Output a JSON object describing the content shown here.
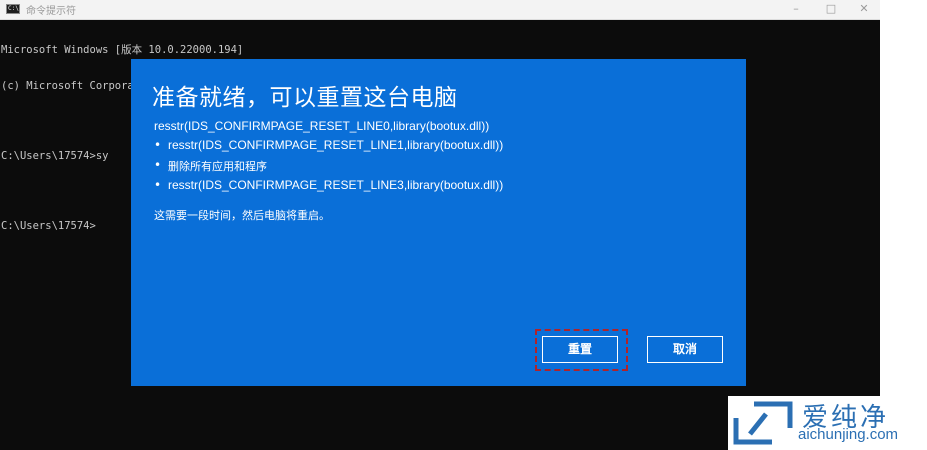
{
  "titlebar": {
    "icon_text": "C:\\",
    "title": "命令提示符",
    "minimize": "–",
    "maximize": "□",
    "close": "✕"
  },
  "console": {
    "lines": [
      "Microsoft Windows [版本 10.0.22000.194]",
      "(c) Microsoft Corporation。保留所有权利。",
      "",
      "C:\\Users\\17574>sy",
      "",
      "C:\\Users\\17574>"
    ]
  },
  "dialog": {
    "title": "准备就绪，可以重置这台电脑",
    "line0": "resstr(IDS_CONFIRMPAGE_RESET_LINE0,library(bootux.dll))",
    "bullets": [
      "resstr(IDS_CONFIRMPAGE_RESET_LINE1,library(bootux.dll))",
      "删除所有应用和程序",
      "resstr(IDS_CONFIRMPAGE_RESET_LINE3,library(bootux.dll))"
    ],
    "note": "这需要一段时间，然后电脑将重启。",
    "reset_button": "重置",
    "cancel_button": "取消",
    "bullet_char": "•"
  },
  "watermark": {
    "cn": "爱纯净",
    "en": "aichunjing.com"
  },
  "colors": {
    "dialog_bg": "#0a6fd8",
    "console_bg": "#0c0c0c",
    "highlight": "#b0232a",
    "logo": "#2b6fb3"
  }
}
